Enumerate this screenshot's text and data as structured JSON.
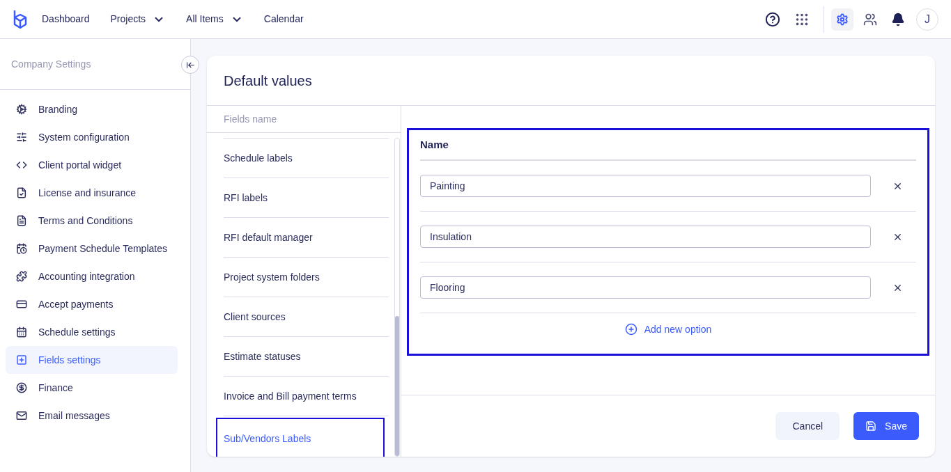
{
  "topnav": {
    "items": [
      {
        "label": "Dashboard",
        "dropdown": false
      },
      {
        "label": "Projects",
        "dropdown": true
      },
      {
        "label": "All Items",
        "dropdown": true
      },
      {
        "label": "Calendar",
        "dropdown": false
      }
    ],
    "avatar": "J",
    "settings_active": true
  },
  "sidebar": {
    "title": "Company Settings",
    "items": [
      {
        "label": "Branding",
        "selected": false
      },
      {
        "label": "System configuration",
        "selected": false
      },
      {
        "label": "Client portal widget",
        "selected": false
      },
      {
        "label": "License and insurance",
        "selected": false
      },
      {
        "label": "Terms and Conditions",
        "selected": false
      },
      {
        "label": "Payment Schedule Templates",
        "selected": false
      },
      {
        "label": "Accounting integration",
        "selected": false
      },
      {
        "label": "Accept payments",
        "selected": false
      },
      {
        "label": "Schedule settings",
        "selected": false
      },
      {
        "label": "Fields settings",
        "selected": true
      },
      {
        "label": "Finance",
        "selected": false
      },
      {
        "label": "Email messages",
        "selected": false
      }
    ]
  },
  "card": {
    "title": "Default values",
    "fields_header": "Fields name",
    "fields": [
      {
        "label": "Schedule labels",
        "selected": false,
        "highlighted": false
      },
      {
        "label": "RFI labels",
        "selected": false,
        "highlighted": false
      },
      {
        "label": "RFI default manager",
        "selected": false,
        "highlighted": false
      },
      {
        "label": "Project system folders",
        "selected": false,
        "highlighted": false
      },
      {
        "label": "Client sources",
        "selected": false,
        "highlighted": false
      },
      {
        "label": "Estimate statuses",
        "selected": false,
        "highlighted": false
      },
      {
        "label": "Invoice and Bill payment terms",
        "selected": false,
        "highlighted": false
      },
      {
        "label": "Sub/Vendors Labels",
        "selected": true,
        "highlighted": true
      }
    ],
    "options": {
      "header": "Name",
      "highlighted": true,
      "values": [
        "Painting",
        "Insulation",
        "Flooring"
      ],
      "add_label": "Add new option"
    },
    "cancel": "Cancel",
    "save": "Save"
  }
}
